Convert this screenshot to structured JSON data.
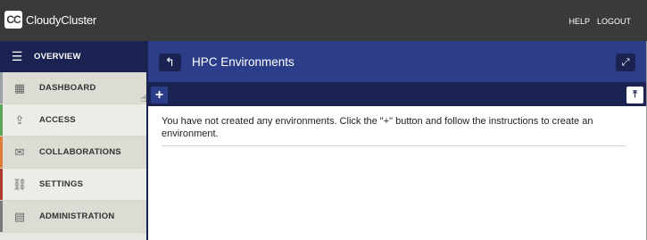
{
  "header": {
    "logo_text": "CC",
    "brand": "CloudyCluster",
    "links": [
      "HELP",
      "LOGOUT"
    ]
  },
  "sidebar": {
    "head_label": "OVERVIEW",
    "items": [
      {
        "label": "DASHBOARD",
        "icon": "building-icon",
        "stripe": "#9aa0a6"
      },
      {
        "label": "ACCESS",
        "icon": "upload-icon",
        "stripe": "#5aa55a"
      },
      {
        "label": "COLLABORATIONS",
        "icon": "envelope-icon",
        "stripe": "#e07b39"
      },
      {
        "label": "SETTINGS",
        "icon": "link-icon",
        "stripe": "#b03a2e"
      },
      {
        "label": "ADMINISTRATION",
        "icon": "id-card-icon",
        "stripe": "#7a7a7a"
      }
    ]
  },
  "main": {
    "title": "HPC Environments",
    "message": "You have not created any environments. Click the \"+\" button and follow the instructions to create an environment."
  },
  "colors": {
    "topbar": "#3a3a3a",
    "navy": "#1a2352",
    "blue": "#2c3e8a"
  }
}
